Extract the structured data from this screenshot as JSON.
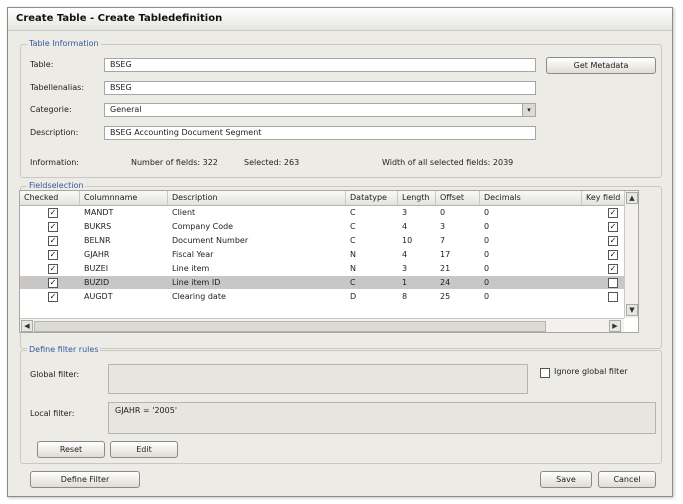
{
  "window": {
    "title": "Create Table - Create Tabledefinition"
  },
  "table_info": {
    "group_title": "Table Information",
    "table_label": "Table:",
    "table_value": "BSEG",
    "alias_label": "Tabellenalias:",
    "alias_value": "BSEG",
    "category_label": "Categorie:",
    "category_value": "General",
    "description_label": "Description:",
    "description_value": "BSEG Accounting Document Segment",
    "get_metadata_label": "Get Metadata",
    "info_label": "Information:",
    "num_fields_text": "Number of fields: 322",
    "selected_text": "Selected: 263",
    "width_text": "Width of all selected fields: 2039"
  },
  "fieldselection": {
    "group_title": "Fieldselection",
    "columns": [
      "Checked",
      "Columnname",
      "Description",
      "Datatype",
      "Length",
      "Offset",
      "Decimals",
      "Key field"
    ],
    "rows": [
      {
        "checked": true,
        "name": "MANDT",
        "desc": "Client",
        "type": "C",
        "length": "3",
        "offset": "0",
        "decimals": "0",
        "key": true
      },
      {
        "checked": true,
        "name": "BUKRS",
        "desc": "Company Code",
        "type": "C",
        "length": "4",
        "offset": "3",
        "decimals": "0",
        "key": true
      },
      {
        "checked": true,
        "name": "BELNR",
        "desc": "Document Number",
        "type": "C",
        "length": "10",
        "offset": "7",
        "decimals": "0",
        "key": true
      },
      {
        "checked": true,
        "name": "GJAHR",
        "desc": "Fiscal Year",
        "type": "N",
        "length": "4",
        "offset": "17",
        "decimals": "0",
        "key": true
      },
      {
        "checked": true,
        "name": "BUZEI",
        "desc": "Line item",
        "type": "N",
        "length": "3",
        "offset": "21",
        "decimals": "0",
        "key": true
      },
      {
        "checked": true,
        "name": "BUZID",
        "desc": "Line item ID",
        "type": "C",
        "length": "1",
        "offset": "24",
        "decimals": "0",
        "key": false
      },
      {
        "checked": true,
        "name": "AUGDT",
        "desc": "Clearing date",
        "type": "D",
        "length": "8",
        "offset": "25",
        "decimals": "0",
        "key": false
      }
    ],
    "selected_row_index": 5
  },
  "filter": {
    "group_title": "Define filter rules",
    "global_label": "Global filter:",
    "global_value": "",
    "ignore_label": "Ignore global filter",
    "ignore_checked": false,
    "local_label": "Local filter:",
    "local_value": "GJAHR = '2005'",
    "reset_label": "Reset",
    "edit_label": "Edit"
  },
  "footer": {
    "define_filter_label": "Define Filter",
    "save_label": "Save",
    "cancel_label": "Cancel"
  }
}
